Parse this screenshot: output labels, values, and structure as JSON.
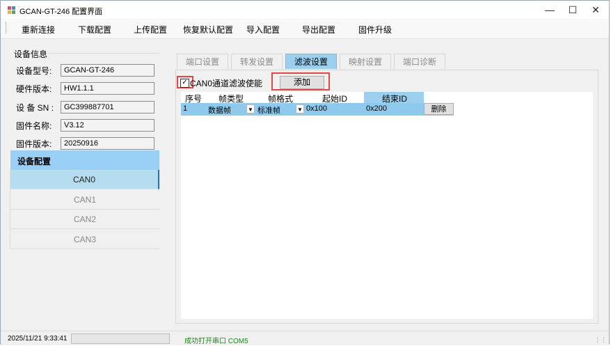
{
  "window": {
    "title": "GCAN-GT-246 配置界面"
  },
  "menu": [
    "重新连接",
    "下载配置",
    "上传配置",
    "恢复默认配置",
    "导入配置",
    "导出配置",
    "固件升级"
  ],
  "device_info": {
    "title": "设备信息",
    "fields": [
      {
        "label": "设备型号:",
        "value": "GCAN-GT-246"
      },
      {
        "label": "硬件版本:",
        "value": "HW1.1.1"
      },
      {
        "label": "设 备 SN :",
        "value": "GC399887701"
      },
      {
        "label": "固件名称:",
        "value": "V3.12"
      },
      {
        "label": "固件版本:",
        "value": "20250916"
      }
    ]
  },
  "device_config": {
    "title": "设备配置",
    "items": [
      "CAN0",
      "CAN1",
      "CAN2",
      "CAN3"
    ],
    "selected": "CAN0"
  },
  "tabs": [
    "端口设置",
    "转发设置",
    "滤波设置",
    "映射设置",
    "端口诊断"
  ],
  "active_tab": "滤波设置",
  "filter": {
    "enable_label": "CAN0通道滤波使能",
    "enabled": true,
    "add_label": "添加",
    "columns": [
      "序号",
      "帧类型",
      "帧格式",
      "起始ID",
      "结束ID"
    ],
    "rows": [
      {
        "index": "1",
        "frame_type": "数据帧",
        "frame_format": "标准帧",
        "start_id": "0x100",
        "end_id": "0x200",
        "delete_label": "删除"
      }
    ]
  },
  "status": {
    "datetime": "2025/11/21 9:33:41",
    "message": "成功打开串口 COM5"
  },
  "colors": {
    "selected_blue": "#9ccfee",
    "highlight_red": "#e04848",
    "status_green": "#1c8a1c"
  }
}
